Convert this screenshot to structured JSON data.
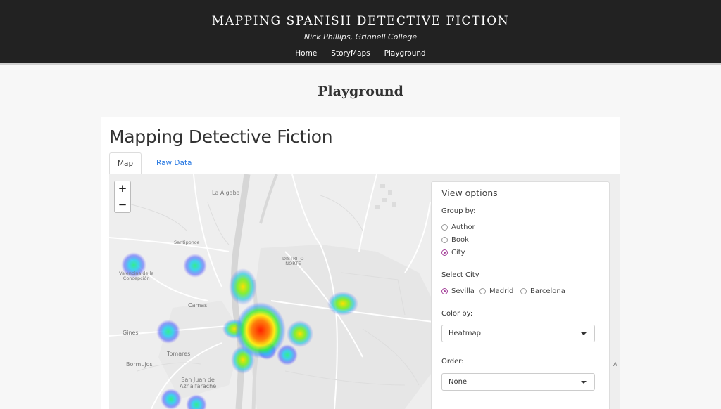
{
  "site": {
    "title": "MAPPING SPANISH DETECTIVE FICTION",
    "subtitle": "Nick Phillips, Grinnell College",
    "nav": [
      "Home",
      "StoryMaps",
      "Playground"
    ]
  },
  "page": {
    "heading": "Playground"
  },
  "card": {
    "title": "Mapping Detective Fiction",
    "tabs": [
      "Map",
      "Raw Data"
    ]
  },
  "map": {
    "zoom_in": "+",
    "zoom_out": "−",
    "labels": {
      "la_algaba": "La Algaba",
      "santiponce": "Santiponce",
      "distrito_norte": "DISTRITO\nNORTE",
      "valencina": "Valencina de la\nConcepción",
      "camas": "Camas",
      "gines": "Gines",
      "tomares": "Tomares",
      "bormujos": "Bormujos",
      "san_juan": "San Juan de\nAznalfarache",
      "edge_a": "A"
    },
    "heatmap_palette": [
      "#4040ff",
      "#00ffff",
      "#00ff00",
      "#ffff00",
      "#ff0000"
    ]
  },
  "options": {
    "title": "View options",
    "group_by_label": "Group by:",
    "group_by": [
      "Author",
      "Book",
      "City"
    ],
    "group_by_selected": "City",
    "city_label": "Select City",
    "cities": [
      "Sevilla",
      "Madrid",
      "Barcelona"
    ],
    "city_selected": "Sevilla",
    "color_by_label": "Color by:",
    "color_by_value": "Heatmap",
    "order_label": "Order:",
    "order_value": "None",
    "accent_color": "#a5449b"
  }
}
